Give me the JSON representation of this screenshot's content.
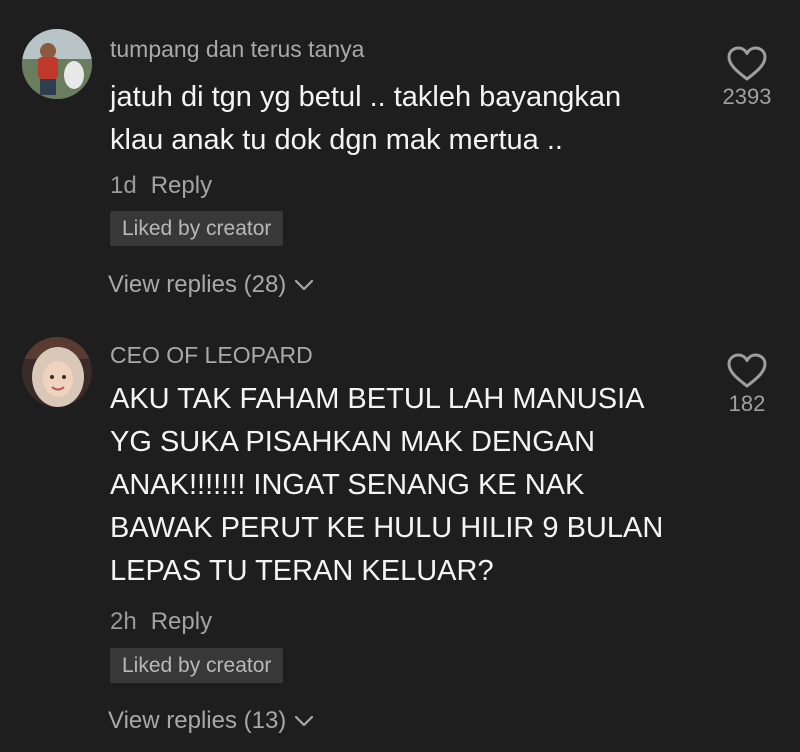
{
  "comments": [
    {
      "username": "tumpang dan terus tanya",
      "lines": [
        "jatuh di tgn yg betul .. takleh bayangkan",
        "klau anak tu dok dgn mak mertua .."
      ],
      "time": "1d",
      "reply_label": "Reply",
      "liked_badge": "Liked by creator",
      "view_replies": "View replies (28)",
      "like_count": "2393",
      "icons": {
        "like": "heart-icon",
        "expand": "chevron-down-icon"
      }
    },
    {
      "username": "CEO OF LEOPARD",
      "lines": [
        "AKU TAK FAHAM BETUL LAH MANUSIA",
        "YG SUKA PISAHKAN MAK DENGAN",
        "ANAK!!!!!!! INGAT SENANG KE NAK",
        "BAWAK PERUT KE HULU HILIR 9 BULAN",
        "LEPAS TU TERAN KELUAR?"
      ],
      "time": "2h",
      "reply_label": "Reply",
      "liked_badge": "Liked by creator",
      "view_replies": "View replies (13)",
      "like_count": "182",
      "icons": {
        "like": "heart-icon",
        "expand": "chevron-down-icon"
      }
    }
  ],
  "colors": {
    "background": "#1e1e1e",
    "text_primary": "#f4f4f4",
    "text_secondary": "#a9a9a9",
    "badge_background": "#383838"
  }
}
